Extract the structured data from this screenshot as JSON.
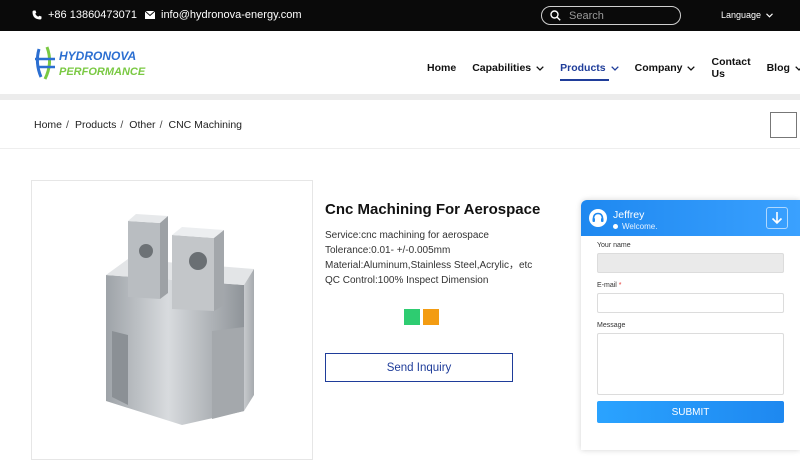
{
  "topbar": {
    "phone": "+86 13860473071",
    "email": "info@hydronova-energy.com",
    "search_placeholder": "Search",
    "language": "Language"
  },
  "logo": {
    "line1": "HYDRONOVA",
    "line2": "PERFORMANCE"
  },
  "nav": [
    {
      "label": "Home",
      "dropdown": false
    },
    {
      "label": "Capabilities",
      "dropdown": true
    },
    {
      "label": "Products",
      "dropdown": true,
      "active": true
    },
    {
      "label": "Company",
      "dropdown": true
    },
    {
      "label": "Contact Us",
      "dropdown": false
    },
    {
      "label": "Blog",
      "dropdown": true
    }
  ],
  "breadcrumb": [
    "Home",
    "Products",
    "Other",
    "CNC Machining"
  ],
  "product": {
    "title": "Cnc Machining For Aerospace",
    "specs": [
      "Service:cnc machining for aerospace",
      "Tolerance:0.01- +/-0.005mm",
      "Material:Aluminum,Stainless Steel,Acrylic，etc",
      "QC Control:100% Inspect Dimension"
    ],
    "swatch_colors": [
      "#2ecc71",
      "#f39c12"
    ],
    "inquiry_label": "Send Inquiry"
  },
  "chat": {
    "agent": "Jeffrey",
    "status": "Welcome.",
    "name_label": "Your name",
    "email_label": "E-mail",
    "email_required": "*",
    "message_label": "Message",
    "submit_label": "SUBMIT"
  },
  "colors": {
    "accent": "#1f3d9a",
    "chat_blue": "#1e88f0",
    "topbar": "#0a0a0a"
  }
}
